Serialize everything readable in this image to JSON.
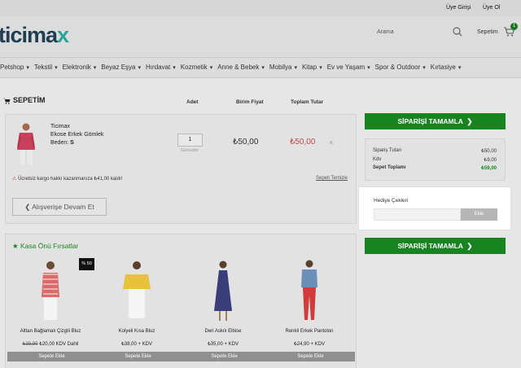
{
  "topbar": {
    "login": "Üye Girişi",
    "register": "Üye Ol"
  },
  "header": {
    "logo_main": "ticima",
    "logo_x": "x",
    "search_label": "Arama",
    "cart_label": "Sepetim",
    "cart_count": "1"
  },
  "nav": [
    "Petshop",
    "Tekstil",
    "Elektronik",
    "Beyaz Eşya",
    "Hırdavat",
    "Kozmetik",
    "Anne & Bebek",
    "Mobilya",
    "Kitap",
    "Ev ve Yaşam",
    "Spor & Outdoor",
    "Kırtasiye"
  ],
  "cart": {
    "title": "SEPETİM",
    "headers": {
      "qty": "Adet",
      "unit": "Birim Fiyat",
      "total": "Toplam Tutar"
    },
    "item": {
      "brand": "Ticimax",
      "name": "Ekose Erkek Gömlek",
      "size_label": "Beden:",
      "size": "S",
      "qty": "1",
      "update": "Güncelle",
      "unit_price": "₺50,00",
      "total_price": "₺50,00",
      "remove": "×"
    },
    "shipping_note": "Ücretsiz kargo hakkı kazanmanıza ₺41,00 kaldı!",
    "clear": "Sepeti Temizle",
    "continue": "Alışverişe Devam Et"
  },
  "summary": {
    "complete": "SİPARİŞİ TAMAMLA",
    "rows": [
      {
        "label": "Sipariş Tutarı",
        "value": "₺50,00"
      },
      {
        "label": "Kdv",
        "value": "₺9,00"
      },
      {
        "label": "Sepet Toplamı",
        "value": "₺59,00"
      }
    ]
  },
  "gift": {
    "title": "Hediye Çekleri",
    "placeholder": "",
    "button": "Ekle"
  },
  "kasa": {
    "title": "Kasa Önü Fırsatlar",
    "discount_badge": "% 50",
    "add_label": "Sepete Ekle",
    "products": [
      {
        "name": "Alttan Bağlamalı Çizgili Bluz",
        "old": "₺39,90",
        "price": "₺20,00 KDV Dahil"
      },
      {
        "name": "Kolyeli Kısa Bluz",
        "old": "",
        "price": "₺38,00  + KDV"
      },
      {
        "name": "Deri Askılı Elbise",
        "old": "",
        "price": "₺35,00  + KDV"
      },
      {
        "name": "Renkli Erkek Pantolon",
        "old": "",
        "price": "₺24,90  + KDV"
      }
    ]
  },
  "colors": {
    "brand_green": "#178420",
    "price_red": "#c24b4b",
    "logo_dark": "#1f3e52",
    "logo_accent": "#2aa39d"
  },
  "icons": [
    "cart-icon",
    "search-icon",
    "chevron-right-icon",
    "chevron-left-icon",
    "star-icon",
    "warning-icon",
    "close-icon"
  ]
}
